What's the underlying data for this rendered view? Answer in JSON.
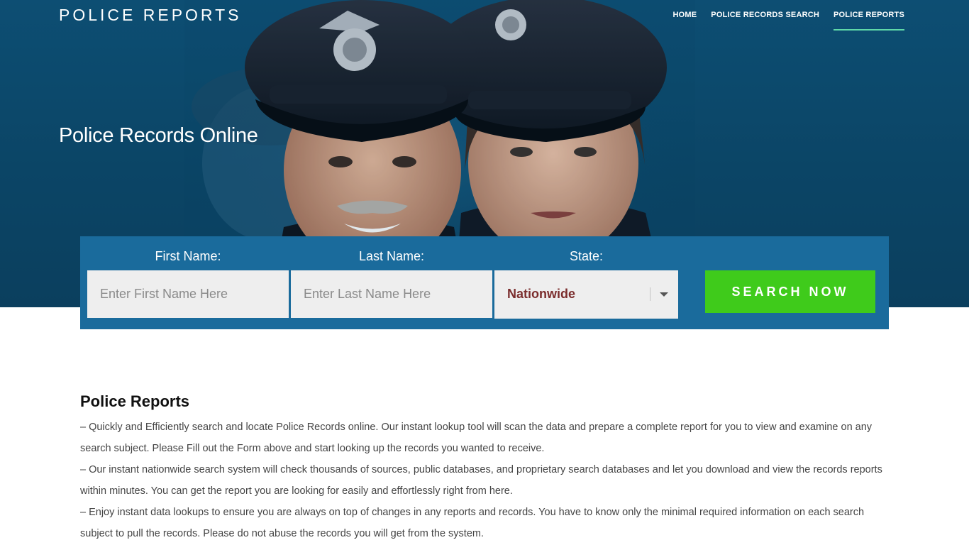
{
  "header": {
    "brand": "POLICE REPORTS",
    "nav": [
      {
        "label": "HOME"
      },
      {
        "label": "POLICE RECORDS SEARCH"
      },
      {
        "label": "POLICE REPORTS",
        "active": true
      }
    ]
  },
  "hero": {
    "title": "Police Records Online"
  },
  "search_form": {
    "first_name": {
      "label": "First Name:",
      "placeholder": "Enter First Name Here"
    },
    "last_name": {
      "label": "Last Name:",
      "placeholder": "Enter Last Name Here"
    },
    "state": {
      "label": "State:",
      "value": "Nationwide"
    },
    "submit_label": "SEARCH NOW"
  },
  "content": {
    "heading": "Police Reports",
    "paragraphs": [
      "– Quickly and Efficiently search and locate Police Records online. Our instant lookup tool will scan the data and prepare a complete report for you to view and examine on any search subject. Please Fill out the Form above and start looking up the records you wanted to receive.",
      "– Our instant nationwide search system will check thousands of sources, public databases, and proprietary search databases and let you download and view the records reports within minutes. You can get the report you are looking for easily and effortlessly right from here.",
      "– Enjoy instant data lookups to ensure you are always on top of changes in any reports and records. You have to know only the minimal required information on each search subject to pull the records. Please do not abuse the records you will get from the system."
    ]
  },
  "colors": {
    "hero_background": "#0b4566",
    "form_background": "#1a6b9c",
    "button": "#3fcb1b",
    "nav_active_underline": "#5fd8a8",
    "state_value": "#7b2d2d"
  }
}
